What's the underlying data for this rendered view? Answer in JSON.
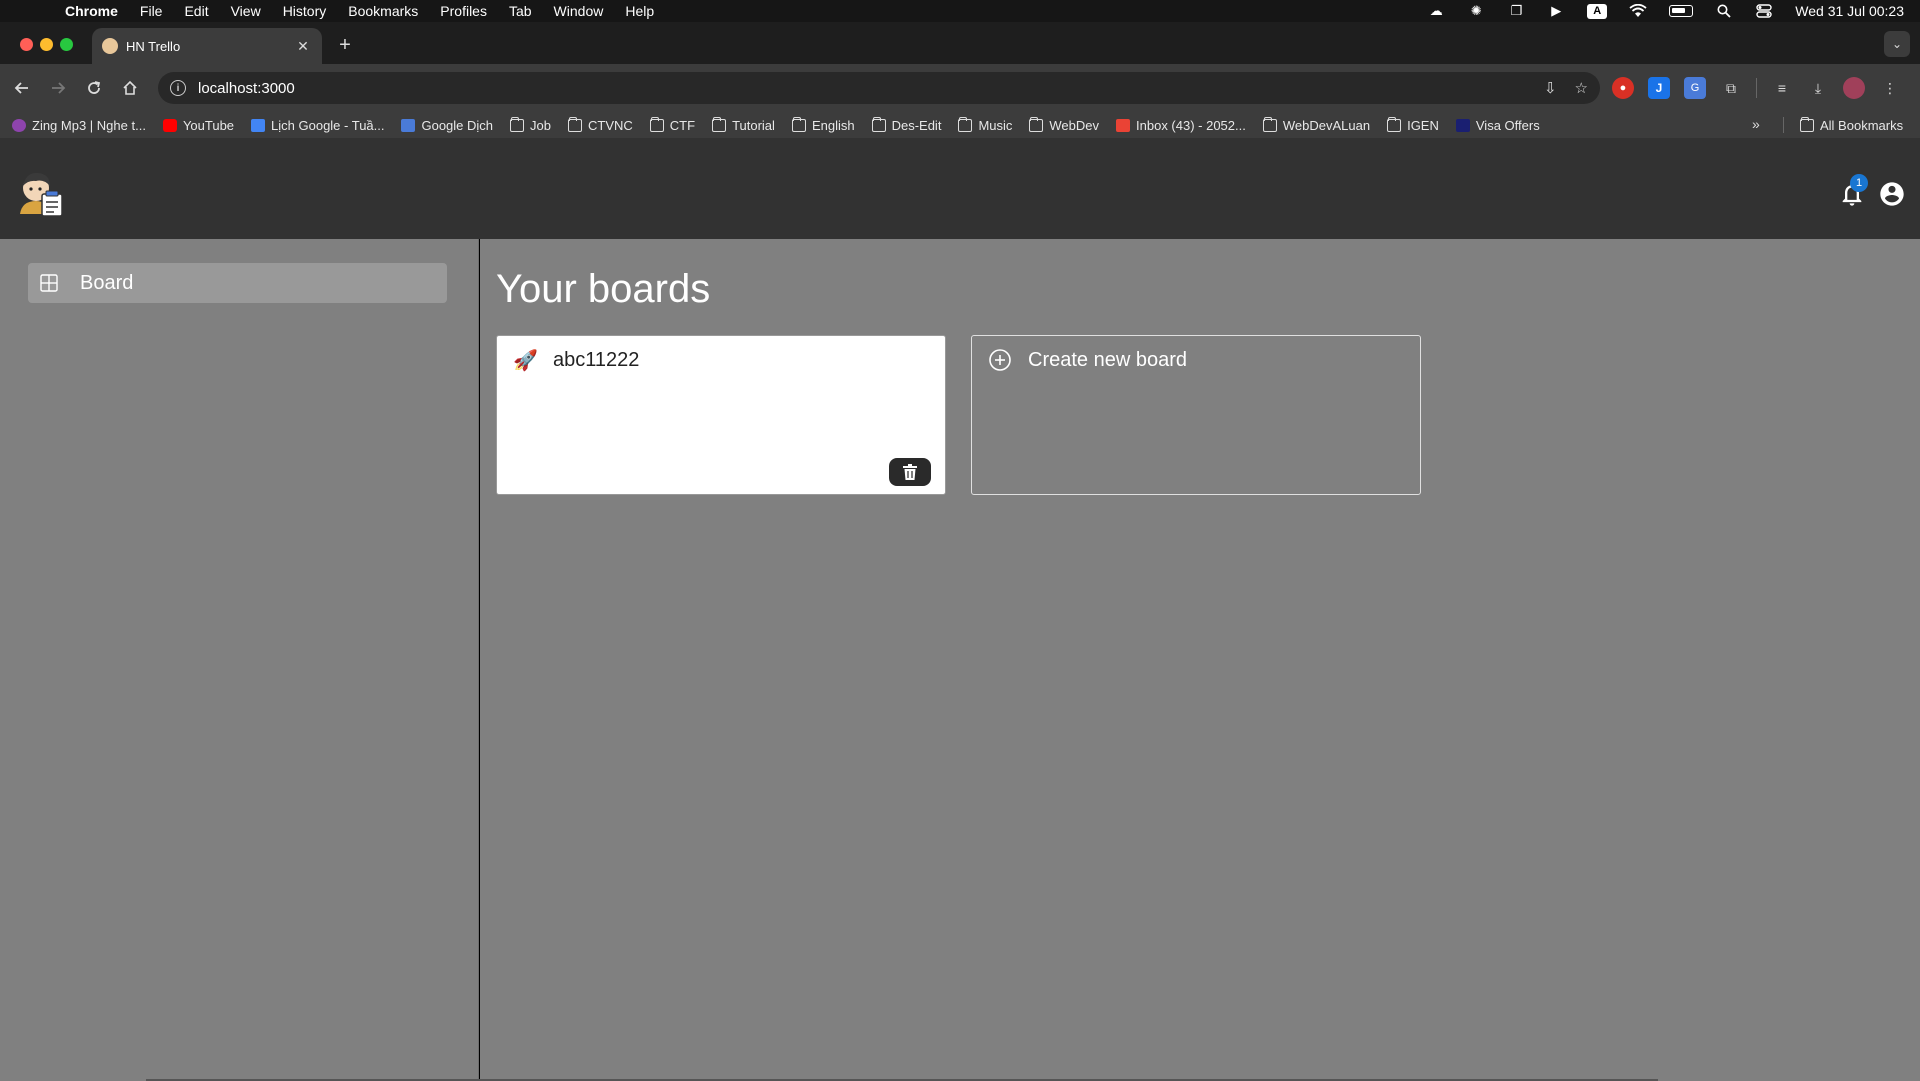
{
  "menubar": {
    "app_name": "Chrome",
    "items": [
      "File",
      "Edit",
      "View",
      "History",
      "Bookmarks",
      "Profiles",
      "Tab",
      "Window",
      "Help"
    ],
    "clock": "Wed 31 Jul  00:23",
    "input_indicator": "A"
  },
  "browser": {
    "tab_title": "HN Trello",
    "url": "localhost:3000",
    "bookmarks": [
      {
        "label": "Zing Mp3 | Nghe t...",
        "icon": "zing-icon"
      },
      {
        "label": "YouTube",
        "icon": "youtube-icon"
      },
      {
        "label": "Lịch Google - Tuầ...",
        "icon": "google-calendar-icon"
      },
      {
        "label": "Google Dịch",
        "icon": "google-translate-icon"
      },
      {
        "label": "Job",
        "icon": "folder-icon"
      },
      {
        "label": "CTVNC",
        "icon": "folder-icon"
      },
      {
        "label": "CTF",
        "icon": "folder-icon"
      },
      {
        "label": "Tutorial",
        "icon": "folder-icon"
      },
      {
        "label": "English",
        "icon": "folder-icon"
      },
      {
        "label": "Des-Edit",
        "icon": "folder-icon"
      },
      {
        "label": "Music",
        "icon": "folder-icon"
      },
      {
        "label": "WebDev",
        "icon": "folder-icon"
      },
      {
        "label": "Inbox (43) - 2052...",
        "icon": "gmail-icon"
      },
      {
        "label": "WebDevALuan",
        "icon": "folder-icon"
      },
      {
        "label": "IGEN",
        "icon": "folder-icon"
      },
      {
        "label": "Visa Offers",
        "icon": "visa-icon"
      }
    ],
    "all_bookmarks": "All Bookmarks"
  },
  "header": {
    "notification_count": "1"
  },
  "sidebar": {
    "items": [
      {
        "label": "Board",
        "icon": "board-icon"
      }
    ]
  },
  "main": {
    "title": "Your boards",
    "boards": [
      {
        "title": "abc11222",
        "emoji": "🚀"
      }
    ],
    "create_label": "Create new board"
  },
  "colors": {
    "app_header": "#323232",
    "content_bg": "#808080",
    "badge": "#1976d2"
  }
}
